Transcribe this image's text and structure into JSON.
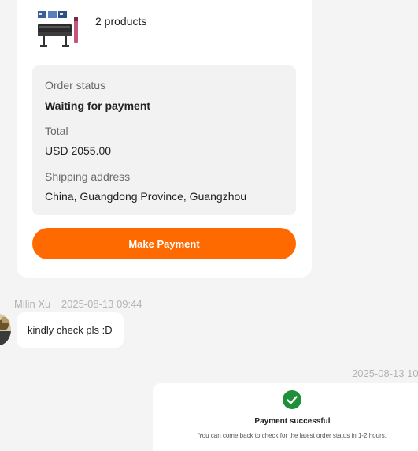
{
  "order": {
    "product_count": "2 products",
    "status_label": "Order status",
    "status_value": "Waiting for payment",
    "total_label": "Total",
    "total_value": "USD 2055.00",
    "shipping_label": "Shipping address",
    "shipping_value": "China, Guangdong Province, Guangzhou",
    "pay_button_label": "Make Payment",
    "product_icon": "printer-product-thumbnail"
  },
  "messages": [
    {
      "sender": "Milin Xu",
      "timestamp": "2025-08-13 09:44",
      "text": "kindly check pls :D"
    }
  ],
  "payment_notice": {
    "timestamp": "2025-08-13 10",
    "title": "Payment successful",
    "subtitle": "You can come back to check for the latest order status in 1-2 hours.",
    "icon": "check-circle-icon"
  },
  "colors": {
    "accent": "#ff6a00",
    "success": "#1f8f3a",
    "background": "#f4f4f4"
  }
}
